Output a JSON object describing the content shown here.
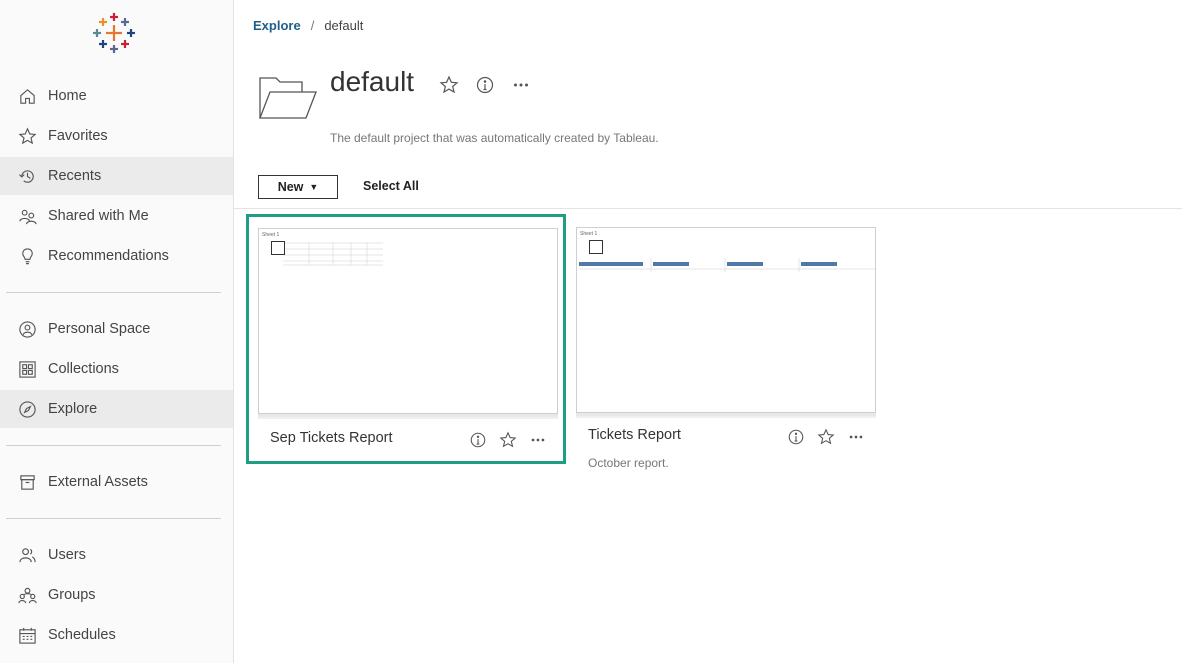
{
  "sidebar": {
    "items": [
      {
        "label": "Home",
        "icon": "home-icon"
      },
      {
        "label": "Favorites",
        "icon": "star-icon"
      },
      {
        "label": "Recents",
        "icon": "history-icon",
        "active": true
      },
      {
        "label": "Shared with Me",
        "icon": "people-icon"
      },
      {
        "label": "Recommendations",
        "icon": "lightbulb-icon"
      },
      {
        "label": "Personal Space",
        "icon": "person-icon"
      },
      {
        "label": "Collections",
        "icon": "collections-icon"
      },
      {
        "label": "Explore",
        "icon": "compass-icon",
        "active": true
      },
      {
        "label": "External Assets",
        "icon": "archive-icon"
      },
      {
        "label": "Users",
        "icon": "users-icon"
      },
      {
        "label": "Groups",
        "icon": "groups-icon"
      },
      {
        "label": "Schedules",
        "icon": "calendar-icon"
      }
    ]
  },
  "breadcrumb": {
    "link": "Explore",
    "separator": "/",
    "current": "default"
  },
  "project": {
    "title": "default",
    "description": "The default project that was automatically created by Tableau."
  },
  "toolbar": {
    "new_label": "New",
    "select_all_label": "Select All"
  },
  "cards": [
    {
      "title": "Sep Tickets Report",
      "description": "",
      "sheet_label": "Sheet 1",
      "selected": true
    },
    {
      "title": "Tickets Report",
      "description": "October report.",
      "sheet_label": "Sheet 1",
      "selected": false
    }
  ],
  "colors": {
    "selection": "#1f9e83",
    "breadcrumb_link": "#1f5f8b",
    "active_nav": "#ebebeb"
  }
}
